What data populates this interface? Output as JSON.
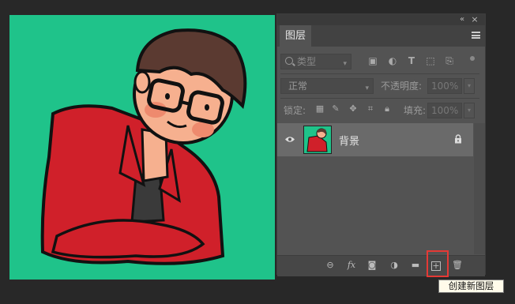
{
  "panel": {
    "collapse_glyph": "«",
    "close_glyph": "×",
    "tab_label": "图层",
    "filter": {
      "label": "类型",
      "icons": [
        "image-filter-icon",
        "adjustment-filter-icon",
        "type-filter-icon",
        "shape-filter-icon",
        "smart-object-filter-icon"
      ]
    },
    "blend": {
      "mode": "正常",
      "opacity_label": "不透明度:",
      "opacity_value": "100%"
    },
    "lock": {
      "label": "锁定:",
      "fill_label": "填充:",
      "fill_value": "100%"
    },
    "layer": {
      "name": "背景",
      "visible": true,
      "locked": true
    },
    "footer_icons": [
      "link-layers-icon",
      "fx-icon",
      "add-mask-icon",
      "adjustment-layer-icon",
      "new-group-icon",
      "new-layer-icon",
      "delete-layer-icon"
    ]
  },
  "tooltip": "创建新图层",
  "colors": {
    "canvas_bg": "#1fc38a",
    "jacket": "#d0202a",
    "skin": "#f6b08f",
    "hair": "#5b3a31",
    "highlight": "#e53935"
  }
}
